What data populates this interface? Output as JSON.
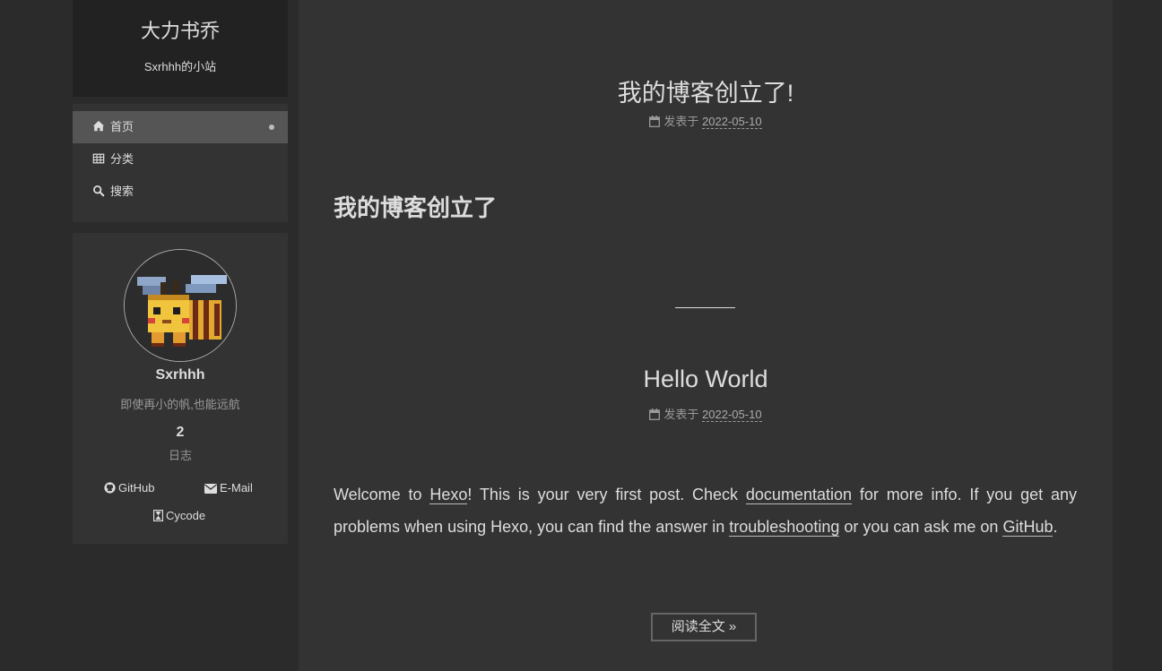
{
  "site": {
    "title": "大力书乔",
    "subtitle": "Sxrhhh的小站"
  },
  "menu": {
    "items": [
      {
        "label": "首页",
        "icon": "home-icon",
        "active": true
      },
      {
        "label": "分类",
        "icon": "grid-icon"
      },
      {
        "label": "搜索",
        "icon": "search-icon"
      }
    ]
  },
  "author": {
    "name": "Sxrhhh",
    "description": "即使再小的帆,也能远航",
    "post_count": "2",
    "post_count_label": "日志",
    "links": [
      {
        "label": "GitHub",
        "icon": "github-icon"
      },
      {
        "label": "E-Mail",
        "icon": "envelope-icon"
      },
      {
        "label": "Cycode",
        "icon": "hourglass-icon"
      }
    ]
  },
  "posts": [
    {
      "title": "我的博客创立了!",
      "meta_label": "发表于",
      "date": "2022-05-10",
      "heading": "我的博客创立了"
    },
    {
      "title": "Hello World",
      "meta_label": "发表于",
      "date": "2022-05-10",
      "body": {
        "t1": "Welcome to ",
        "link1": "Hexo",
        "t2": "! This is your very first post. Check ",
        "link2": "documentation",
        "t3": " for more info. If you get any problems when using Hexo, you can find the answer in ",
        "link3": "troubleshooting",
        "t4": " or you can ask me on ",
        "link4": "GitHub",
        "t5": "."
      },
      "read_more": "阅读全文 »"
    }
  ],
  "colors": {
    "page_bg": "#2b2b2b",
    "panel_bg": "#333333",
    "brand_bg": "#222222",
    "active_menu_bg": "#555555",
    "text": "#dddddd",
    "muted": "#999999"
  }
}
